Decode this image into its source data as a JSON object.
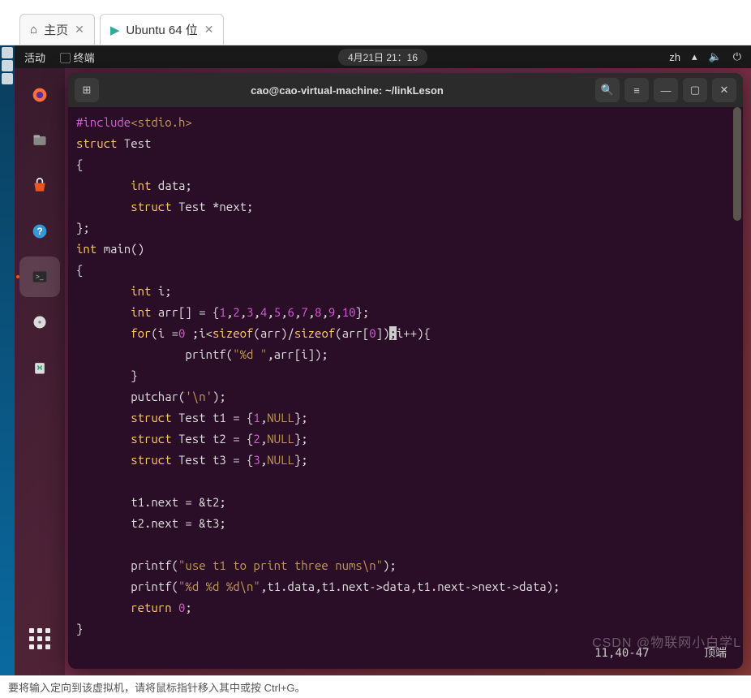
{
  "vmware": {
    "tabs": [
      {
        "icon": "home-icon",
        "label": "主页"
      },
      {
        "icon": "vm-icon",
        "label": "Ubuntu 64 位"
      }
    ],
    "status_text": "要将输入定向到该虚拟机，请将鼠标指针移入其中或按 Ctrl+G。"
  },
  "ubuntu": {
    "activities": "活动",
    "app_indicator": "终端",
    "clock": "4月21日 21：16",
    "lang": "zh"
  },
  "dock": {
    "items": [
      {
        "name": "firefox-icon"
      },
      {
        "name": "files-icon"
      },
      {
        "name": "software-icon"
      },
      {
        "name": "help-icon"
      },
      {
        "name": "terminal-icon",
        "active": true
      },
      {
        "name": "disk-icon"
      },
      {
        "name": "trash-icon"
      }
    ]
  },
  "terminal": {
    "title": "cao@cao-virtual-machine: ~/linkLeson",
    "status_pos": "11,40-47",
    "status_right": "顶端",
    "code": {
      "l1_pre": "#include",
      "l1_inc": "<stdio.h>",
      "l2": "struct",
      "l2b": " Test",
      "l3": "{",
      "l4_kw": "int",
      "l4_t": " data;",
      "l5_kw": "struct",
      "l5_t": " Test *next;",
      "l6": "};",
      "l7_kw": "int",
      "l7_t": " main()",
      "l8": "{",
      "l9_kw": "int",
      "l9_t": " i;",
      "l10_kw": "int",
      "l10_t1": " arr[] = {",
      "l10_t2": "};",
      "nums": [
        "1",
        "2",
        "3",
        "4",
        "5",
        "6",
        "7",
        "8",
        "9",
        "10"
      ],
      "l11_kw1": "for",
      "l11_t1": "(i =",
      "l11_n0": "0",
      "l11_t2": " ;i<",
      "l11_kw2": "sizeof",
      "l11_t3": "(arr)/",
      "l11_kw3": "sizeof",
      "l11_t4": "(arr[",
      "l11_n1": "0",
      "l11_t5": "])",
      "l11_cur": ";",
      "l11_t6": "i++){",
      "l12_t1": "printf(",
      "l12_s": "\"%d \"",
      "l12_t2": ",arr[i]);",
      "l13": "}",
      "l14_t1": "putchar(",
      "l14_s": "'\\n'",
      "l14_t2": ");",
      "l15_kw": "struct",
      "l15_t1": " Test t1 = {",
      "l15_n": "1",
      "l15_c": "NULL",
      "l15_t2": "};",
      "l16_kw": "struct",
      "l16_t1": " Test t2 = {",
      "l16_n": "2",
      "l16_c": "NULL",
      "l16_t2": "};",
      "l17_kw": "struct",
      "l17_t1": " Test t3 = {",
      "l17_n": "3",
      "l17_c": "NULL",
      "l17_t2": "};",
      "l19": "t1.next = &t2;",
      "l20": "t2.next = &t3;",
      "l22_t1": "printf(",
      "l22_s": "\"use t1 to print three nums\\n\"",
      "l22_t2": ");",
      "l23_t1": "printf(",
      "l23_s": "\"%d %d %d\\n\"",
      "l23_t2": ",t1.data,t1.next->data,t1.next->next->data);",
      "l24_kw": "return",
      "l24_n": "0",
      "l24_t": ";",
      "l25": "}"
    }
  },
  "watermark": "CSDN @物联网小白学L"
}
